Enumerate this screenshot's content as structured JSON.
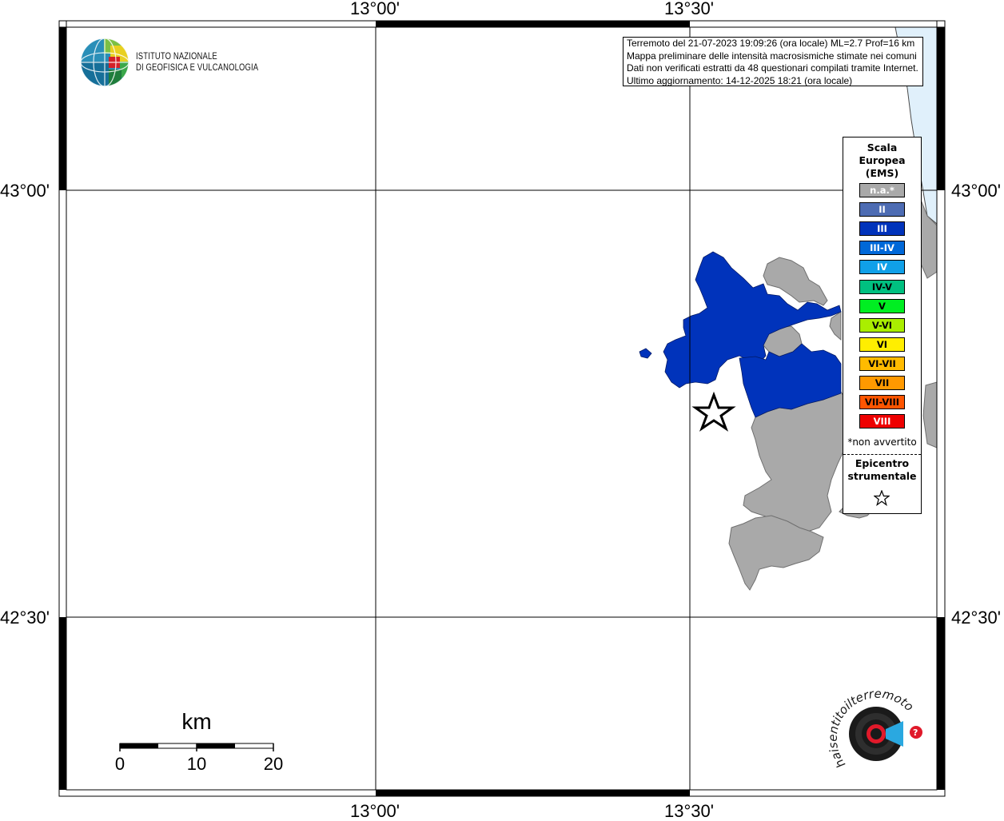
{
  "map": {
    "lon_labels": [
      "13°00'",
      "13°30'"
    ],
    "lat_labels": [
      "43°00'",
      "42°30'"
    ],
    "sea_color": "#e0f0fb",
    "no_data_color": "#a9a9a9",
    "epicenter_symbol": "star"
  },
  "logo": {
    "line1": "ISTITUTO NAZIONALE",
    "line2": "DI GEOFISICA E VULCANOLOGIA",
    "icon": "ingv-globe-logo"
  },
  "info": {
    "line1": "Terremoto del 21-07-2023 19:09:26 (ora locale) ML=2.7 Prof=16 km",
    "line2": "Mappa preliminare delle intensità macrosismiche stimate nei comuni",
    "line3": "Dati non verificati estratti da 48 questionari compilati tramite Internet.",
    "line4": "Ultimo aggiornamento: 14-12-2025 18:21 (ora locale)"
  },
  "legend": {
    "title_line1": "Scala",
    "title_line2": "Europea",
    "title_line3": "(EMS)",
    "items": [
      {
        "label": "n.a.*",
        "color": "#a9a9a9",
        "text_color": "#ffffff"
      },
      {
        "label": "II",
        "color": "#4d6cb3",
        "text_color": "#ffffff"
      },
      {
        "label": "III",
        "color": "#0033bb",
        "text_color": "#ffffff"
      },
      {
        "label": "III-IV",
        "color": "#0068d8",
        "text_color": "#ffffff"
      },
      {
        "label": "IV",
        "color": "#10a0e8",
        "text_color": "#ffffff"
      },
      {
        "label": "IV-V",
        "color": "#00c080",
        "text_color": "#000000"
      },
      {
        "label": "V",
        "color": "#00ee22",
        "text_color": "#000000"
      },
      {
        "label": "V-VI",
        "color": "#aaee00",
        "text_color": "#000000"
      },
      {
        "label": "VI",
        "color": "#ffee00",
        "text_color": "#000000"
      },
      {
        "label": "VI-VII",
        "color": "#ffbb00",
        "text_color": "#000000"
      },
      {
        "label": "VII",
        "color": "#ff9900",
        "text_color": "#000000"
      },
      {
        "label": "VII-VIII",
        "color": "#ff5500",
        "text_color": "#000000"
      },
      {
        "label": "VIII",
        "color": "#ee0000",
        "text_color": "#ffffff"
      }
    ],
    "note": "*non avvertito",
    "epicenter_line1": "Epicentro",
    "epicenter_line2": "strumentale"
  },
  "scale_bar": {
    "unit": "km",
    "labels": [
      "0",
      "10",
      "20"
    ]
  },
  "hsit_logo": {
    "text": "haisentitoilterremoto.it",
    "website": "www.haisentitoilterremoto.it",
    "icon": "hsit-speaker-logo"
  }
}
